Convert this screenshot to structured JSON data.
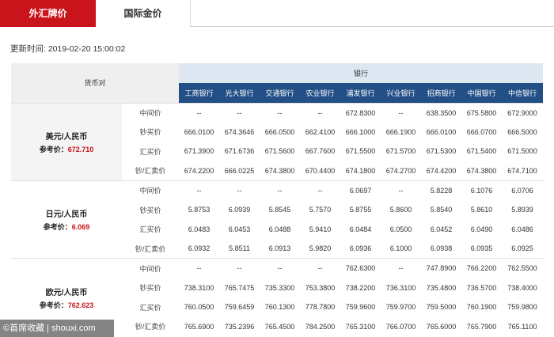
{
  "tabs": [
    {
      "label": "外汇牌价",
      "active": true
    },
    {
      "label": "国际金价",
      "active": false
    }
  ],
  "update_time": "更新时间: 2019-02-20 15:00:02",
  "table": {
    "currency_header": "货币对",
    "bank_group_header": "银行",
    "banks": [
      "工商银行",
      "光大银行",
      "交通银行",
      "农业银行",
      "浦发银行",
      "兴业银行",
      "招商银行",
      "中国银行",
      "中信银行"
    ],
    "ref_label": "参考价：",
    "groups": [
      {
        "name": "美元/人民币",
        "ref": "672.710",
        "rows": [
          {
            "type": "中间价",
            "values": [
              "--",
              "--",
              "--",
              "--",
              "672.8300",
              "--",
              "638.3500",
              "675.5800",
              "672.9000"
            ]
          },
          {
            "type": "钞买价",
            "values": [
              "666.0100",
              "674.3646",
              "666.0500",
              "662.4100",
              "666.1000",
              "666.1900",
              "666.0100",
              "666.0700",
              "666.5000"
            ]
          },
          {
            "type": "汇买价",
            "values": [
              "671.3900",
              "671.6736",
              "671.5600",
              "667.7600",
              "671.5500",
              "671.5700",
              "671.5300",
              "671.5400",
              "671.5000"
            ]
          },
          {
            "type": "钞/汇卖价",
            "values": [
              "674.2200",
              "666.0225",
              "674.3800",
              "670.4400",
              "674.1800",
              "674.2700",
              "674.4200",
              "674.3800",
              "674.7100"
            ]
          }
        ]
      },
      {
        "name": "日元/人民币",
        "ref": "6.069",
        "rows": [
          {
            "type": "中间价",
            "values": [
              "--",
              "--",
              "--",
              "--",
              "6.0697",
              "--",
              "5.8228",
              "6.1076",
              "6.0706"
            ]
          },
          {
            "type": "钞买价",
            "values": [
              "5.8753",
              "6.0939",
              "5.8545",
              "5.7570",
              "5.8755",
              "5.8600",
              "5.8540",
              "5.8610",
              "5.8939"
            ]
          },
          {
            "type": "汇买价",
            "values": [
              "6.0483",
              "6.0453",
              "6.0488",
              "5.9410",
              "6.0484",
              "6.0500",
              "6.0452",
              "6.0490",
              "6.0486"
            ]
          },
          {
            "type": "钞/汇卖价",
            "values": [
              "6.0932",
              "5.8511",
              "6.0913",
              "5.9820",
              "6.0936",
              "6.1000",
              "6.0938",
              "6.0935",
              "6.0925"
            ]
          }
        ]
      },
      {
        "name": "欧元/人民币",
        "ref": "762.623",
        "rows": [
          {
            "type": "中间价",
            "values": [
              "--",
              "--",
              "--",
              "--",
              "762.6300",
              "--",
              "747.8900",
              "766.2200",
              "762.5500"
            ]
          },
          {
            "type": "钞买价",
            "values": [
              "738.3100",
              "765.7475",
              "735.3300",
              "753.3800",
              "738.2200",
              "736.3100",
              "735.4800",
              "736.5700",
              "738.4000"
            ]
          },
          {
            "type": "汇买价",
            "values": [
              "760.0500",
              "759.6459",
              "760.1300",
              "778.7800",
              "759.9600",
              "759.9700",
              "759.5000",
              "760.1900",
              "759.9800"
            ]
          },
          {
            "type": "钞/汇卖价",
            "values": [
              "765.6900",
              "735.2396",
              "765.4500",
              "784.2500",
              "765.3100",
              "766.0700",
              "765.6000",
              "765.7900",
              "765.1100"
            ]
          }
        ]
      }
    ]
  },
  "watermark": "©首席收藏 | shouxi.com"
}
